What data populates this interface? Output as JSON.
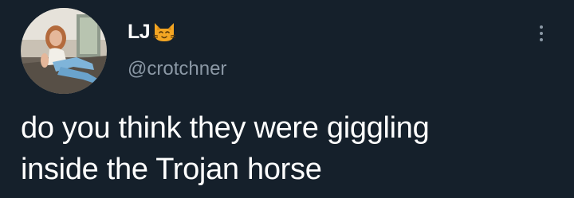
{
  "tweet": {
    "author": {
      "display_name": "LJ",
      "name_emoji": "cat-face-icon",
      "handle": "@crotchner",
      "avatar": "profile-photo"
    },
    "menu_icon": "more-vertical-icon",
    "text_lines": [
      "do you think they were giggling",
      "inside the Trojan horse"
    ]
  },
  "colors": {
    "background": "#15202b",
    "primary_text": "#ffffff",
    "secondary_text": "#8b98a5",
    "emoji": "#f4a623"
  }
}
